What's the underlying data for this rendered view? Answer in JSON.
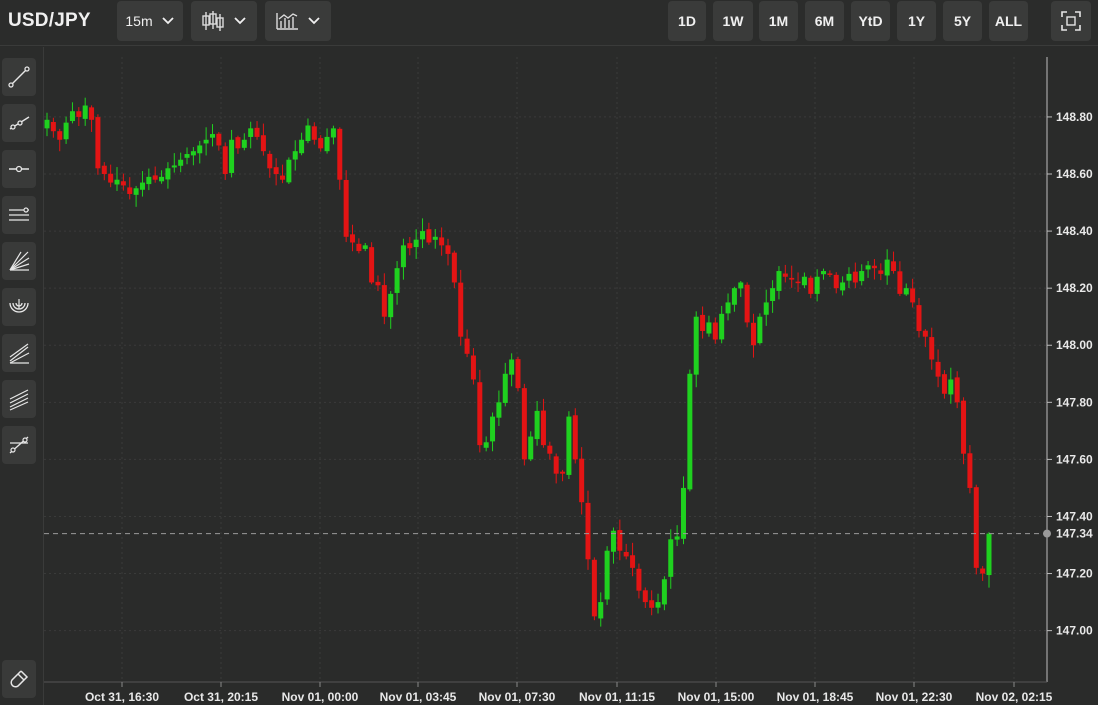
{
  "header": {
    "symbol": "USD/JPY",
    "interval_label": "15m",
    "chart_type_icon": "candlestick-icon",
    "indicators_icon": "indicators-icon",
    "ranges": [
      "1D",
      "1W",
      "1M",
      "6M",
      "YtD",
      "1Y",
      "5Y",
      "ALL"
    ],
    "fullscreen_icon": "fullscreen-icon"
  },
  "sidebar": {
    "tools": [
      "trend-line-icon",
      "ray-icon",
      "horizontal-line-icon",
      "parallel-channel-icon",
      "fib-fan-icon",
      "fib-arcs-icon",
      "pitchfork-icon",
      "fib-channel-icon",
      "multi-point-line-icon"
    ],
    "bottom_tool": "magnet-icon"
  },
  "colors": {
    "up": "#1fd11f",
    "down": "#e31414",
    "background": "#2a2b2a",
    "grid": "#3a3b3a"
  },
  "chart_data": {
    "type": "candlestick",
    "symbol": "USD/JPY",
    "interval": "15m",
    "y_ticks": [
      148.8,
      148.6,
      148.4,
      148.2,
      148.0,
      147.8,
      147.6,
      147.4,
      147.2,
      147.0
    ],
    "y_tick_labels": [
      "148.80",
      "148.60",
      "148.40",
      "148.20",
      "148.00",
      "147.80",
      "147.60",
      "147.40",
      "147.20",
      "147.00"
    ],
    "ylim": [
      146.82,
      149.01
    ],
    "x_tick_labels": [
      "Oct 31, 16:30",
      "Oct 31, 20:15",
      "Nov 01, 00:00",
      "Nov 01, 03:45",
      "Nov 01, 07:30",
      "Nov 01, 11:15",
      "Nov 01, 15:00",
      "Nov 01, 18:45",
      "Nov 01, 22:30",
      "Nov 02, 02:15"
    ],
    "last_price": 147.34,
    "last_price_label": "147.34",
    "grid": true,
    "candle_close_path": [
      148.79,
      148.75,
      148.72,
      148.78,
      148.82,
      148.8,
      148.84,
      148.79,
      148.62,
      148.6,
      148.57,
      148.58,
      148.56,
      148.53,
      148.55,
      148.57,
      148.59,
      148.58,
      148.59,
      148.62,
      148.63,
      148.65,
      148.67,
      148.68,
      148.7,
      148.72,
      148.74,
      148.7,
      148.6,
      148.72,
      148.69,
      148.72,
      148.76,
      148.73,
      148.68,
      148.62,
      148.6,
      148.58,
      148.65,
      148.68,
      148.72,
      148.77,
      148.72,
      148.69,
      148.73,
      148.76,
      148.58,
      148.38,
      148.36,
      148.33,
      148.35,
      148.22,
      148.21,
      148.1,
      148.18,
      148.27,
      148.35,
      148.34,
      148.37,
      148.4,
      148.36,
      148.38,
      148.35,
      148.32,
      148.22,
      148.03,
      147.97,
      147.88,
      147.65,
      147.66,
      147.75,
      147.8,
      147.9,
      147.95,
      147.85,
      147.6,
      147.68,
      147.77,
      147.65,
      147.62,
      147.55,
      147.55,
      147.75,
      147.6,
      147.45,
      147.25,
      147.05,
      147.1,
      147.28,
      147.35,
      147.28,
      147.26,
      147.22,
      147.14,
      147.1,
      147.08,
      147.1,
      147.18,
      147.32,
      147.33,
      147.5,
      147.9,
      148.1,
      148.05,
      148.08,
      148.02,
      148.11,
      148.15,
      148.2,
      148.22,
      148.08,
      148.0,
      148.1,
      148.15,
      148.2,
      148.26,
      148.24,
      148.23,
      148.22,
      148.24,
      148.18,
      148.24,
      148.26,
      148.25,
      148.2,
      148.22,
      148.25,
      148.22,
      148.26,
      148.28,
      148.27,
      148.25,
      148.3,
      148.26,
      148.18,
      148.2,
      148.15,
      148.05,
      148.03,
      147.95,
      147.89,
      147.83,
      147.88,
      147.8,
      147.62,
      147.5,
      147.22,
      147.2,
      147.34
    ]
  }
}
